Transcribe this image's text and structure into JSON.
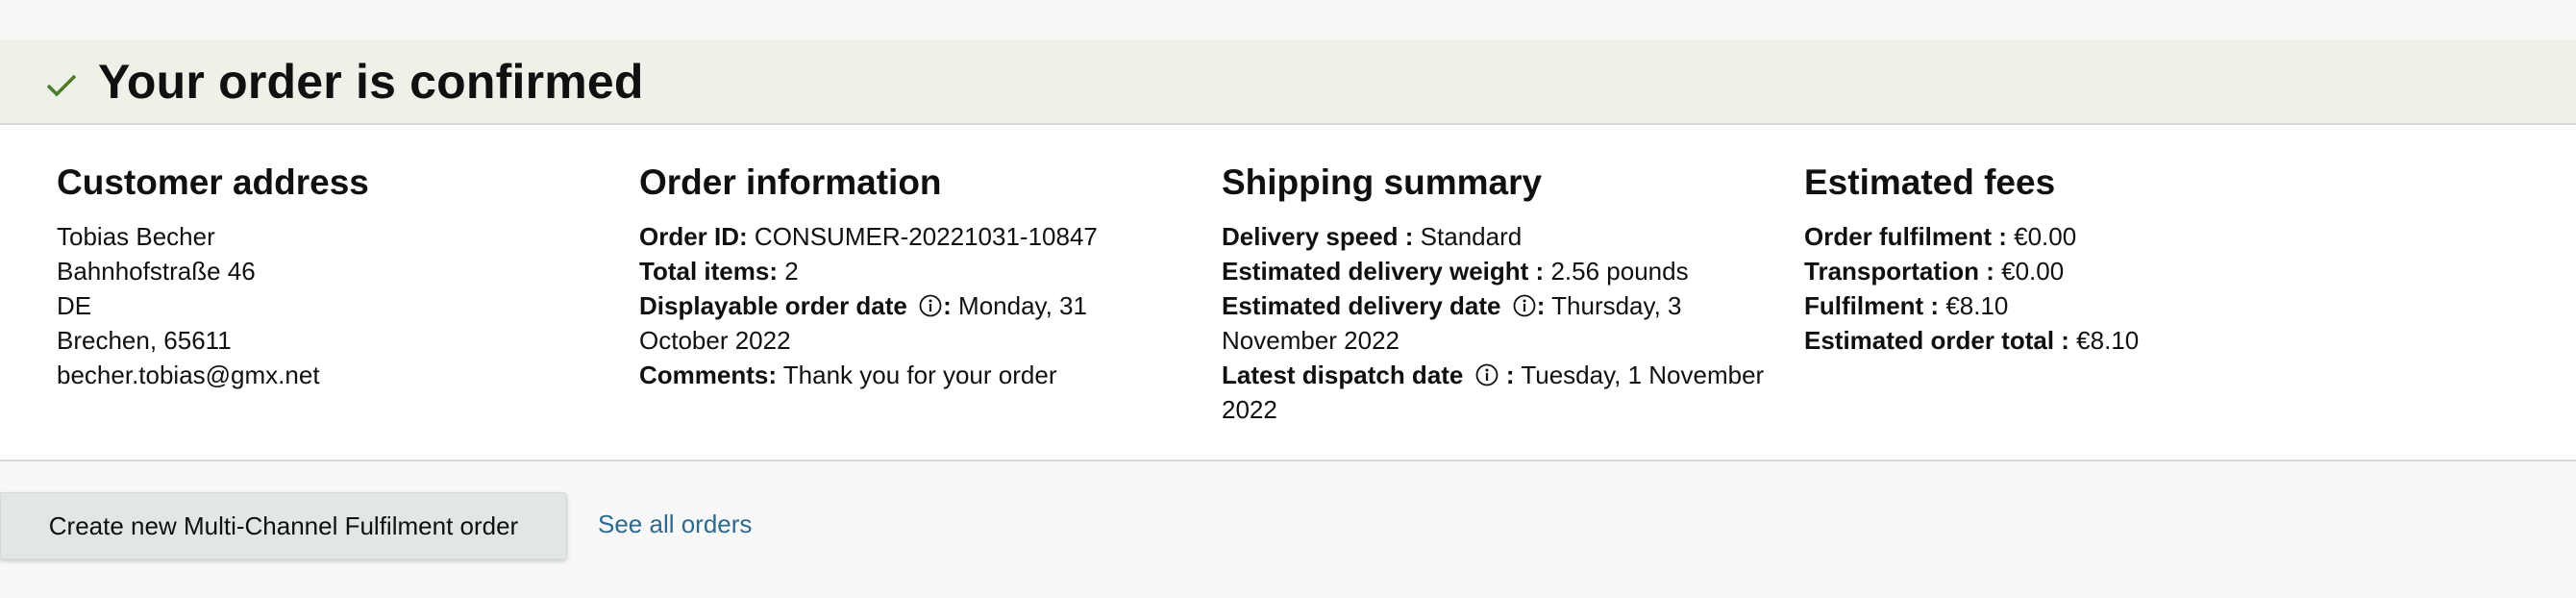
{
  "banner": {
    "title": "Your order is confirmed"
  },
  "customer_address": {
    "heading": "Customer address",
    "lines": [
      "Tobias Becher",
      "Bahnhofstraße 46",
      "DE",
      "Brechen, 65611",
      "becher.tobias@gmx.net"
    ]
  },
  "order_information": {
    "heading": "Order information",
    "order_id_label": "Order ID:",
    "order_id_value": "CONSUMER-20221031-10847",
    "total_items_label": "Total items:",
    "total_items_value": "2",
    "order_date_label": "Displayable order date",
    "order_date_colon": ":",
    "order_date_value_1": "Monday, 31",
    "order_date_value_2": "October 2022",
    "comments_label": "Comments:",
    "comments_value": "Thank you for your order"
  },
  "shipping_summary": {
    "heading": "Shipping summary",
    "speed_label": "Delivery speed :",
    "speed_value": "Standard",
    "weight_label": "Estimated delivery weight :",
    "weight_value": "2.56 pounds",
    "delivery_date_label": "Estimated delivery date",
    "delivery_date_colon": ":",
    "delivery_date_value_1": "Thursday, 3",
    "delivery_date_value_2": "November 2022",
    "dispatch_label": "Latest dispatch date",
    "dispatch_colon": ":",
    "dispatch_value_1": "Tuesday, 1 November",
    "dispatch_value_2": "2022"
  },
  "estimated_fees": {
    "heading": "Estimated fees",
    "fulfilment_order_label": "Order fulfilment :",
    "fulfilment_order_value": "€0.00",
    "transportation_label": "Transportation :",
    "transportation_value": "€0.00",
    "fulfilment_label": "Fulfilment :",
    "fulfilment_value": "€8.10",
    "total_label": "Estimated order total :",
    "total_value": "€8.10"
  },
  "actions": {
    "create_button": "Create new Multi-Channel Fulfilment order",
    "see_all_link": "See all orders"
  },
  "colors": {
    "banner_bg": "#eef1e8",
    "check": "#4a7a2a",
    "link": "#2c6a8f"
  },
  "icons": {
    "check": "check-icon",
    "info": "info-icon"
  }
}
